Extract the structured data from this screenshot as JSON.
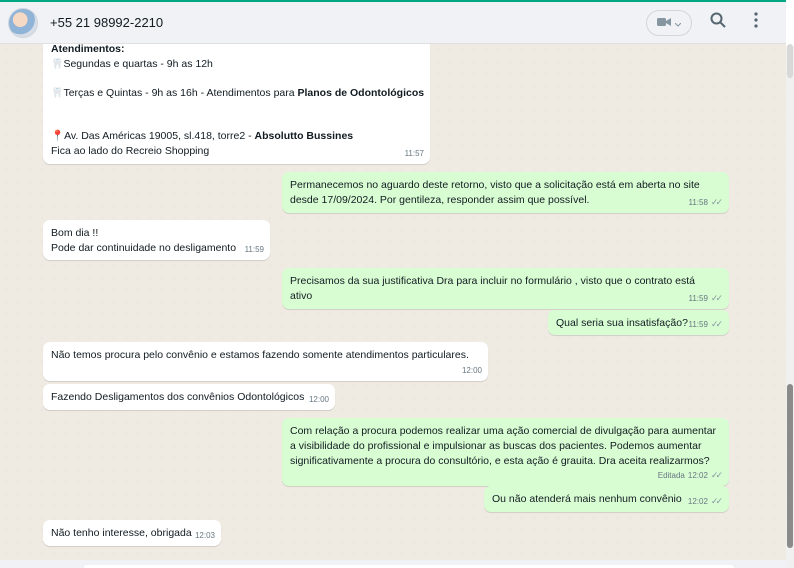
{
  "header": {
    "contact_name": "+55 21 98992-2210",
    "icons": [
      "avatar",
      "video-call-icon",
      "chevron-down-icon",
      "search-icon",
      "menu-icon"
    ]
  },
  "messages": [
    {
      "id": "m1",
      "direction": "in",
      "lines": {
        "l1": "Atendimentos:",
        "l2": "Segundas e quartas - 9h as 12h",
        "l3a": "Terças e Quintas - 9h as 16h - Atendimentos para ",
        "l3b": "Planos de Odontológicos",
        "l4a": "Av. Das Américas 19005, sl.418, torre2 - ",
        "l4b": "Absolutto Bussines",
        "l5": "Fica ao lado do Recreio Shopping"
      },
      "time": "11:57"
    },
    {
      "id": "m2",
      "direction": "out",
      "line1": "Permanecemos no aguardo deste retorno, visto que a solicitação está em aberta no site",
      "line2": "desde 17/09/2024. Por gentileza, responder assim que possível.",
      "time": "11:58"
    },
    {
      "id": "m3",
      "direction": "in",
      "line1": "Bom dia !!",
      "line2": "Pode dar continuidade no desligamento",
      "time": "11:59"
    },
    {
      "id": "m4",
      "direction": "out",
      "line1": "Precisamos da sua justificativa Dra para incluir no formulário , visto que o contrato está",
      "line2": "ativo",
      "time": "11:59"
    },
    {
      "id": "m5",
      "direction": "out",
      "line1": "Qual seria sua insatisfação?",
      "time": "11:59"
    },
    {
      "id": "m6",
      "direction": "in",
      "line1": "Não temos procura pelo convênio e estamos fazendo somente atendimentos particulares.",
      "time": "12:00"
    },
    {
      "id": "m7",
      "direction": "in",
      "line1": "Fazendo Desligamentos dos convênios Odontológicos",
      "time": "12:00"
    },
    {
      "id": "m8",
      "direction": "out",
      "line1": "Com relação a procura podemos realizar uma ação comercial de divulgação para aumentar",
      "line2": "a visibilidade do profissional e impulsionar as buscas dos pacientes. Podemos aumentar",
      "line3": "significativamente a procura do consultório, e esta ação é grauita. Dra aceita realizarmos?",
      "edited": "Editada",
      "time": "12:02"
    },
    {
      "id": "m9",
      "direction": "out",
      "line1": "Ou não atenderá mais nenhum convênio",
      "time": "12:02"
    },
    {
      "id": "m10",
      "direction": "in",
      "line1": "Não tenho interesse, obrigada",
      "time": "12:03"
    }
  ],
  "colors": {
    "incoming_bubble": "#ffffff",
    "outgoing_bubble": "#d9fdd3",
    "chat_background": "#efeae2",
    "accent": "#00a884"
  }
}
